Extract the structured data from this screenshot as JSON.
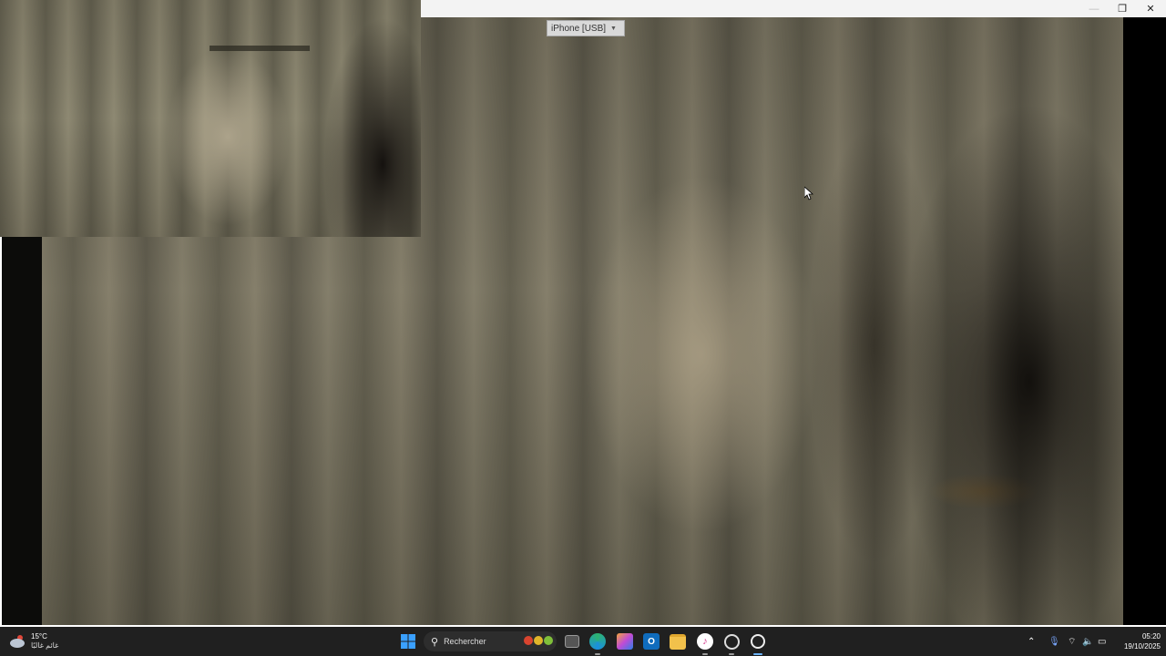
{
  "window": {
    "controls": {
      "minimize": "—",
      "maximize": "❐",
      "close": "✕"
    }
  },
  "camera": {
    "device_select": {
      "value": "iPhone [USB]"
    }
  },
  "taskbar": {
    "weather": {
      "temp": "15°C",
      "condition": "غائم غالبًا"
    },
    "search": {
      "placeholder": "Rechercher"
    },
    "clock": {
      "time": "05:20",
      "date": "19/10/2025"
    },
    "apps": [
      "start-icon",
      "search-icon",
      "task-view-icon",
      "edge-icon",
      "copilot-icon",
      "outlook-icon",
      "file-explorer-icon",
      "itunes-icon",
      "chatgpt-icon",
      "webcam-app-icon"
    ],
    "tray": [
      "chevron-up-icon",
      "microphone-icon",
      "wifi-icon",
      "volume-icon",
      "battery-icon"
    ],
    "accent": "#0078d4"
  }
}
